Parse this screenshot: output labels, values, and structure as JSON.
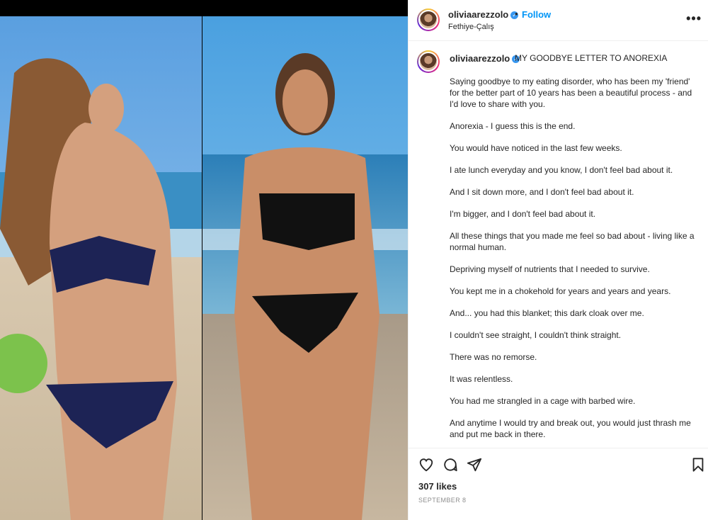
{
  "post": {
    "username": "oliviaarezzolo",
    "follow_label": "Follow",
    "separator": "•",
    "location": "Fethiye-Çalış",
    "more_label": "•••",
    "caption_title": "MY GOODBYE LETTER TO ANOREXIA",
    "caption_paragraphs": [
      "Saying goodbye to my eating disorder, who has been my 'friend' for the better part of 10 years has been a beautiful process - and I'd love to share with you.",
      "Anorexia -  I guess this is the end.",
      "You would have noticed in the last few weeks.",
      "I ate lunch everyday and you know, I don't feel bad about it.",
      "And I sit down more, and I don't feel bad about it.",
      "I'm bigger, and I don't feel bad about it.",
      "All these things that you made me feel so bad about - living like a normal human.",
      "Depriving myself of nutrients that I needed to survive.",
      "You kept me in a chokehold for years and years and years.",
      "And... you had this blanket; this dark cloak over me.",
      "I couldn't see straight, I couldn't think straight.",
      "There was no remorse.",
      "It was relentless.",
      "You had me strangled in a cage with barbed wire.",
      "And anytime I would try and break out, you would just thrash me and put me back in there."
    ],
    "likes": "307 likes",
    "date": "SEPTEMBER 8"
  },
  "icons": {
    "verified": "verified-badge-icon",
    "like": "heart-icon",
    "comment": "comment-icon",
    "share": "share-icon",
    "save": "bookmark-icon"
  },
  "colors": {
    "accent": "#0095f6",
    "verified": "#3897f0",
    "muted": "#8e8e8e"
  }
}
